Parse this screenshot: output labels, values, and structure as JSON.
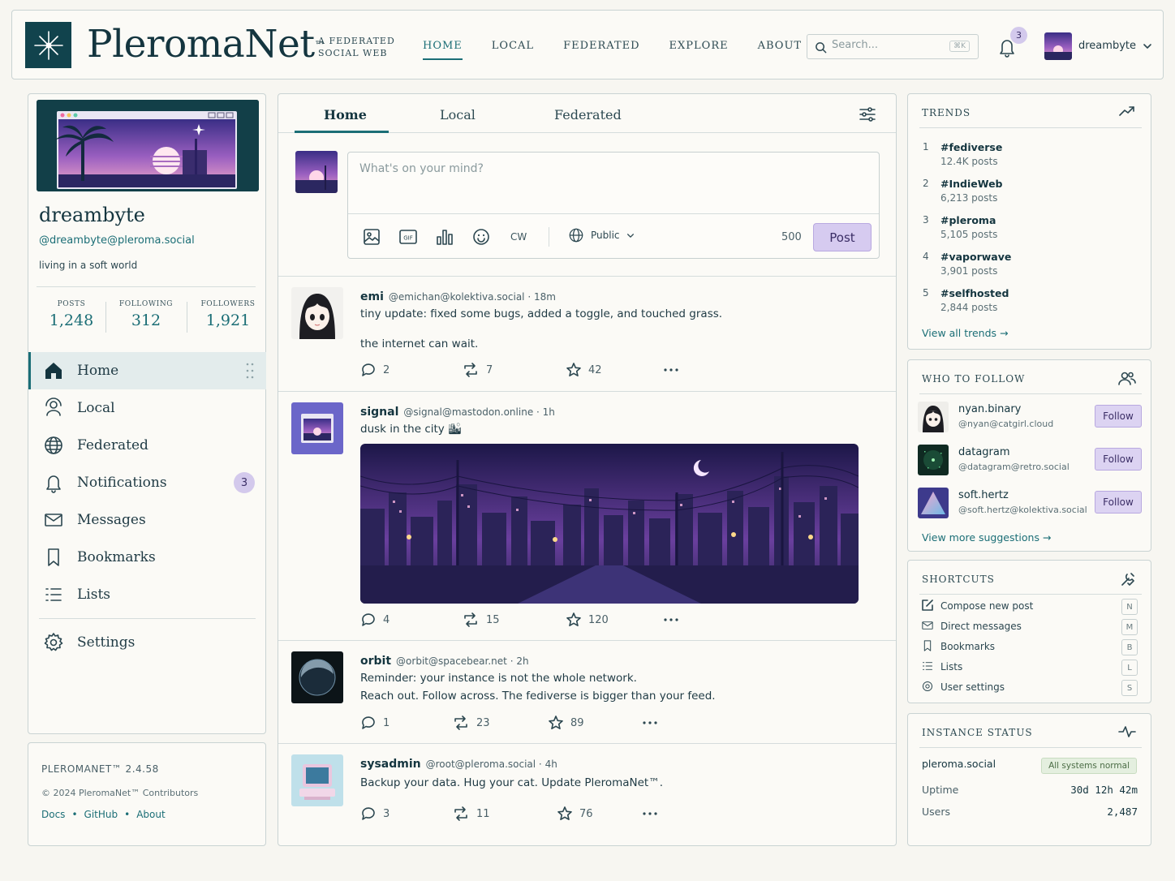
{
  "brand": {
    "name": "PleromaNet",
    "tm": "™",
    "tagline": "A Federated Social Web"
  },
  "nav": [
    {
      "label": "Home",
      "active": true
    },
    {
      "label": "Local"
    },
    {
      "label": "Federated"
    },
    {
      "label": "Explore"
    },
    {
      "label": "About"
    }
  ],
  "search": {
    "placeholder": "Search...",
    "shortcut": "⌘K"
  },
  "notifications": {
    "count": "3"
  },
  "user": {
    "name": "dreambyte"
  },
  "profile": {
    "name": "dreambyte",
    "handle": "@dreambyte@pleroma.social",
    "bio": "living in a soft world",
    "stats": [
      {
        "label": "Posts",
        "value": "1,248"
      },
      {
        "label": "Following",
        "value": "312"
      },
      {
        "label": "Followers",
        "value": "1,921"
      }
    ]
  },
  "menu": [
    {
      "label": "Home",
      "icon": "home-icon",
      "active": true
    },
    {
      "label": "Local",
      "icon": "local-icon"
    },
    {
      "label": "Federated",
      "icon": "globe-icon"
    },
    {
      "label": "Notifications",
      "icon": "bell-icon",
      "badge": "3"
    },
    {
      "label": "Messages",
      "icon": "envelope-icon"
    },
    {
      "label": "Bookmarks",
      "icon": "bookmark-icon"
    },
    {
      "label": "Lists",
      "icon": "list-icon"
    },
    {
      "label": "Settings",
      "icon": "gear-icon"
    }
  ],
  "footer": {
    "version": "PLEROMANET™ 2.4.58",
    "copyright": "© 2024 PleromaNet™ Contributors",
    "links": [
      "Docs",
      "GitHub",
      "About"
    ]
  },
  "tabs": [
    {
      "label": "Home",
      "active": true
    },
    {
      "label": "Local"
    },
    {
      "label": "Federated"
    }
  ],
  "composer": {
    "placeholder": "What's on your mind?",
    "cw": "CW",
    "visibility": "Public",
    "char_count": "500",
    "post_label": "Post"
  },
  "posts": [
    {
      "name": "emi",
      "handle": "@emichan@kolektiva.social",
      "time": "18m",
      "lines": [
        "tiny update: fixed some bugs, added a toggle, and touched grass.",
        "the internet can wait."
      ],
      "replies": "2",
      "boosts": "7",
      "favs": "42"
    },
    {
      "name": "signal",
      "handle": "@signal@mastodon.online",
      "time": "1h",
      "lines": [
        "dusk in the city 🏙"
      ],
      "replies": "4",
      "boosts": "15",
      "favs": "120"
    },
    {
      "name": "orbit",
      "handle": "@orbit@spacebear.net",
      "time": "2h",
      "lines": [
        "Reminder: your instance is not the whole network.",
        "Reach out. Follow across. The fediverse is bigger than your feed."
      ],
      "replies": "1",
      "boosts": "23",
      "favs": "89"
    },
    {
      "name": "sysadmin",
      "handle": "@root@pleroma.social",
      "time": "4h",
      "lines": [
        "Backup your data. Hug your cat. Update PleromaNet™."
      ],
      "replies": "3",
      "boosts": "11",
      "favs": "76"
    }
  ],
  "trends": {
    "title": "Trends",
    "items": [
      {
        "rank": "1",
        "tag": "#fediverse",
        "count": "12.4K posts"
      },
      {
        "rank": "2",
        "tag": "#IndieWeb",
        "count": "6,213 posts"
      },
      {
        "rank": "3",
        "tag": "#pleroma",
        "count": "5,105 posts"
      },
      {
        "rank": "4",
        "tag": "#vaporwave",
        "count": "3,901 posts"
      },
      {
        "rank": "5",
        "tag": "#selfhosted",
        "count": "2,844 posts"
      }
    ],
    "link": "View all trends →"
  },
  "who_to_follow": {
    "title": "Who to follow",
    "items": [
      {
        "name": "nyan.binary",
        "handle": "@nyan@catgirl.cloud",
        "button": "Follow"
      },
      {
        "name": "datagram",
        "handle": "@datagram@retro.social",
        "button": "Follow"
      },
      {
        "name": "soft.hertz",
        "handle": "@soft.hertz@kolektiva.social",
        "button": "Follow"
      }
    ],
    "link": "View more suggestions →"
  },
  "shortcuts": {
    "title": "Shortcuts",
    "items": [
      {
        "label": "Compose new post",
        "key": "N",
        "icon": "compose-icon"
      },
      {
        "label": "Direct messages",
        "key": "M",
        "icon": "envelope-icon"
      },
      {
        "label": "Bookmarks",
        "key": "B",
        "icon": "bookmark-icon"
      },
      {
        "label": "Lists",
        "key": "L",
        "icon": "list-icon"
      },
      {
        "label": "User settings",
        "key": "S",
        "icon": "gear-icon"
      }
    ]
  },
  "instance": {
    "title": "Instance Status",
    "name": "pleroma.social",
    "status": "All systems normal",
    "uptime_label": "Uptime",
    "uptime": "30d 12h 42m",
    "users_label": "Users",
    "users": "2,487"
  },
  "colors": {
    "accent": "#1b6e76",
    "brand_dark": "#11434d",
    "badge": "#d3c9ec",
    "background": "#f7f6f1"
  }
}
